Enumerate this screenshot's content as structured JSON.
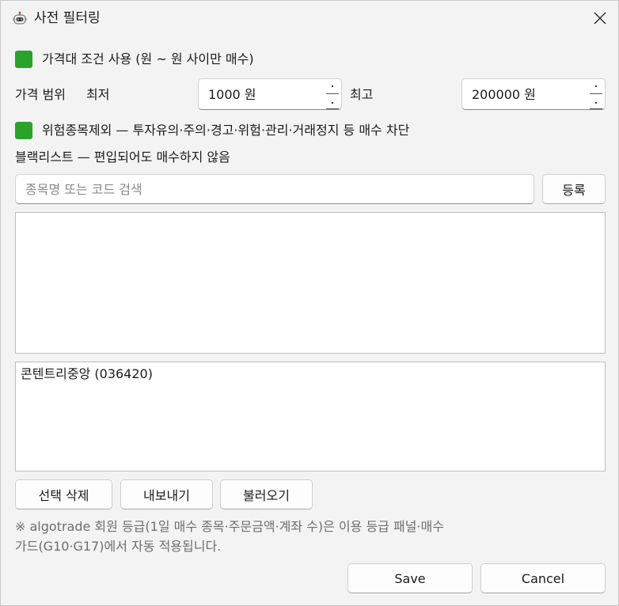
{
  "window": {
    "title": "사전 필터링",
    "icon": "robot-icon",
    "close_icon": "close-icon"
  },
  "price_condition": {
    "checked": true,
    "label": "가격대 조건 사용 (원 ~ 원 사이만 매수)"
  },
  "price_range": {
    "label": "가격 범위",
    "min_label": "최저",
    "min_value": "1000 원",
    "max_label": "최고",
    "max_value": "200000 원"
  },
  "risk_exclude": {
    "checked": true,
    "label": "위험종목제외 — 투자유의·주의·경고·위험·관리·거래정지 등 매수 차단"
  },
  "blacklist": {
    "heading": "블랙리스트 — 편입되어도 매수하지 않음",
    "search_placeholder": "종목명 또는 코드 검색",
    "register_label": "등록",
    "search_results": [],
    "items": [
      "콘텐트리중앙 (036420)"
    ],
    "delete_label": "선택 삭제",
    "export_label": "내보내기",
    "import_label": "불러오기"
  },
  "note": {
    "line1": "※ algotrade 회원 등급(1일 매수 종목·주문금액·계좌 수)은 이용 등급 패널·매수",
    "line2": "가드(G10·G17)에서 자동 적용됩니다."
  },
  "footer": {
    "save_label": "Save",
    "cancel_label": "Cancel"
  },
  "colors": {
    "checkbox": "#28a428",
    "background": "#f3f3f3"
  }
}
